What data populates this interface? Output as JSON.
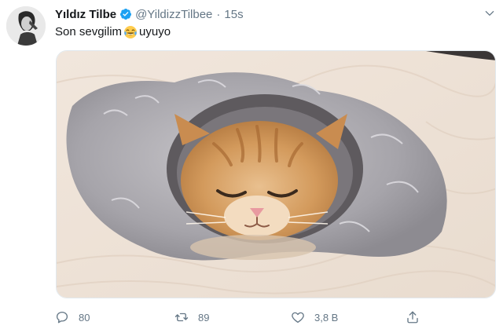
{
  "tweet": {
    "author_name": "Yıldız Tilbe",
    "author_handle": "@YildizzTilbee",
    "separator": "·",
    "timestamp": "15s",
    "text_before_emoji": "Son sevgilim",
    "emoji": "crying-laughing-face-emoji",
    "text_after_emoji": " uyuyo",
    "verified": true
  },
  "media": {
    "description_icon": "kitten-in-fur-hood-photo"
  },
  "actions": {
    "reply_count": "80",
    "retweet_count": "89",
    "like_count": "3,8 B"
  },
  "colors": {
    "text_primary": "#14171a",
    "text_secondary": "#657786",
    "verified_blue": "#1da1f2",
    "border": "#e1e8ed"
  }
}
